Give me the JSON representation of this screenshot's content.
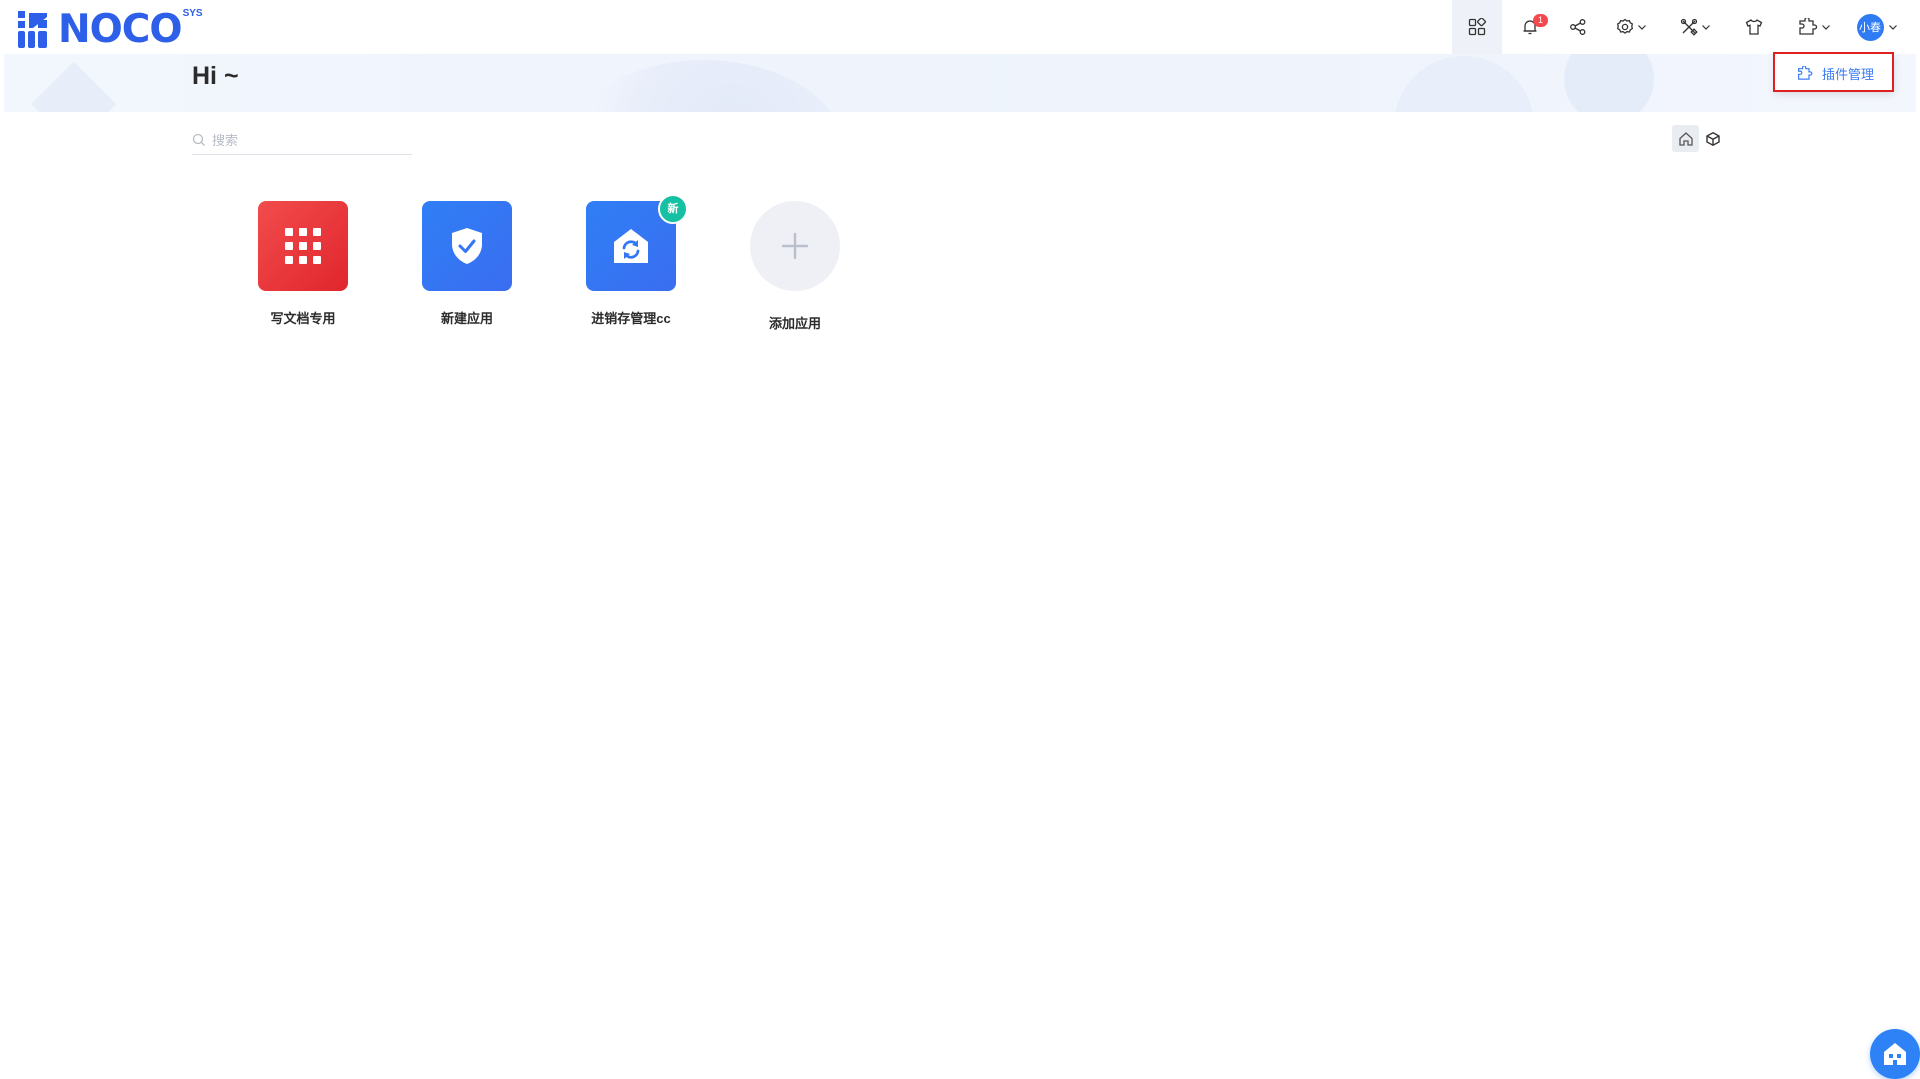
{
  "brand": {
    "name": "NOCO",
    "superscript": "SYS",
    "color": "#2d5fe8"
  },
  "header": {
    "notification_count": "1",
    "avatar_text": "小春",
    "icons": [
      "apps-grid-icon",
      "bell-icon",
      "share-icon",
      "gear-icon",
      "tools-icon",
      "shirt-icon",
      "puzzle-icon"
    ]
  },
  "plugin_menu": {
    "item_label": "插件管理",
    "item_icon": "puzzle-icon"
  },
  "banner": {
    "greeting": "Hi ~"
  },
  "search": {
    "placeholder": "搜索",
    "value": ""
  },
  "view_toggle": {
    "options": [
      "home-icon",
      "cube-icon"
    ],
    "active": "home-icon"
  },
  "apps": [
    {
      "label": "写文档专用",
      "color": "#e8353a",
      "icon": "grid-icon",
      "badge": ""
    },
    {
      "label": "新建应用",
      "color": "#3377f5",
      "icon": "shield-check-icon",
      "badge": ""
    },
    {
      "label": "进销存管理cc",
      "color": "#3377f5",
      "icon": "home-sync-icon",
      "badge": "新"
    }
  ],
  "add_app": {
    "label": "添加应用"
  },
  "colors": {
    "accent": "#3a7bf6",
    "badge_red": "#f5484d",
    "badge_green": "#16c0a2",
    "highlight": "#e02020"
  }
}
